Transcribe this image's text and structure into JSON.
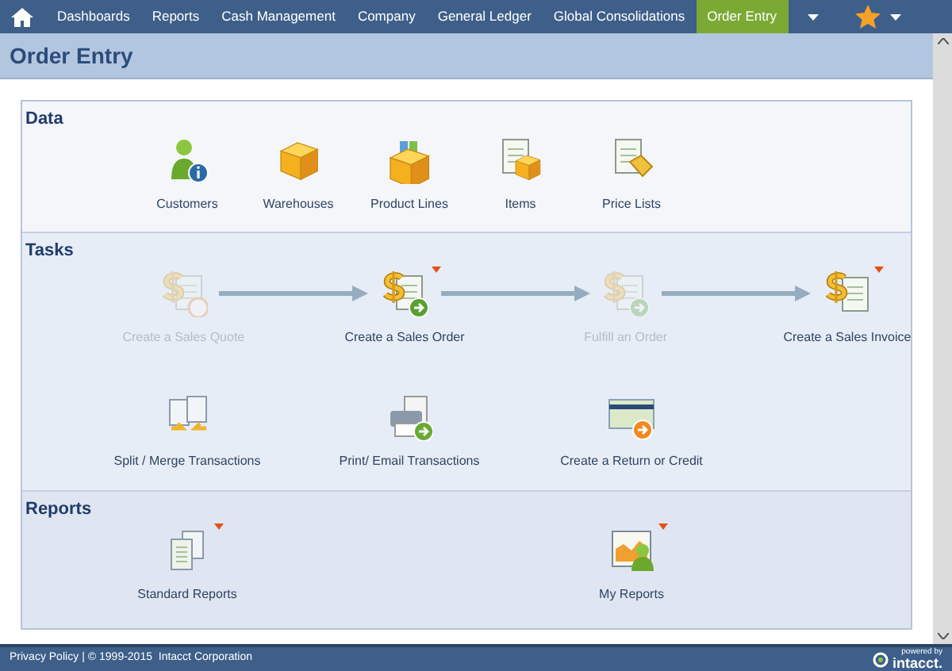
{
  "nav": {
    "tabs": [
      {
        "label": "Dashboards",
        "selected": false
      },
      {
        "label": "Reports",
        "selected": false
      },
      {
        "label": "Cash Management",
        "selected": false
      },
      {
        "label": "Company",
        "selected": false
      },
      {
        "label": "General Ledger",
        "selected": false
      },
      {
        "label": "Global Consolidations",
        "selected": false
      },
      {
        "label": "Order Entry",
        "selected": true
      }
    ]
  },
  "page_title": "Order Entry",
  "sections": [
    {
      "title": "Data",
      "items": [
        {
          "label": "Customers",
          "disabled": false,
          "has_menu": false
        },
        {
          "label": "Warehouses",
          "disabled": false,
          "has_menu": false
        },
        {
          "label": "Product Lines",
          "disabled": false,
          "has_menu": false
        },
        {
          "label": "Items",
          "disabled": false,
          "has_menu": false
        },
        {
          "label": "Price Lists",
          "disabled": false,
          "has_menu": false
        }
      ]
    },
    {
      "title": "Tasks",
      "flow": [
        {
          "label": "Create a Sales Quote",
          "disabled": true,
          "has_menu": false
        },
        {
          "label": "Create a Sales Order",
          "disabled": false,
          "has_menu": true
        },
        {
          "label": "Fulfill an Order",
          "disabled": true,
          "has_menu": false
        },
        {
          "label": "Create a Sales Invoice",
          "disabled": false,
          "has_menu": true
        }
      ],
      "items": [
        {
          "label": "Split / Merge Transactions",
          "disabled": false,
          "has_menu": false
        },
        {
          "label": "Print/ Email Transactions",
          "disabled": false,
          "has_menu": false
        },
        {
          "label": "Create a Return or Credit",
          "disabled": false,
          "has_menu": false
        }
      ]
    },
    {
      "title": "Reports",
      "items": [
        {
          "label": "Standard Reports",
          "disabled": false,
          "has_menu": true
        },
        {
          "label": "My Reports",
          "disabled": false,
          "has_menu": true
        }
      ]
    }
  ],
  "footer": {
    "link": "Privacy Policy",
    "separator": "|",
    "copyright": "© 1999-2015  Intacct Corporation",
    "brand_caption": "powered by",
    "brand_name": "intacct."
  }
}
